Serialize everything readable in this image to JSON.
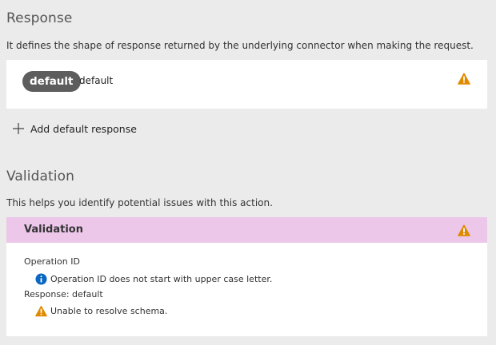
{
  "response": {
    "title": "Response",
    "description": "It defines the shape of response returned by the underlying connector when making the request.",
    "item": {
      "badge": "default",
      "name": "default",
      "status_icon": "warning-icon"
    },
    "add_label": "Add default response"
  },
  "validation": {
    "title": "Validation",
    "description": "This helps you identify potential issues with this action.",
    "header": "Validation",
    "groups": [
      {
        "label": "Operation ID",
        "message": "Operation ID does not start with upper case letter.",
        "icon": "info-icon"
      },
      {
        "label": "Response: default",
        "message": "Unable to resolve schema.",
        "icon": "warning-icon"
      }
    ]
  },
  "colors": {
    "warning": "#e08a00",
    "info": "#0a67c2",
    "validation_header": "#ecc7ea",
    "badge": "#5d5d5d"
  }
}
